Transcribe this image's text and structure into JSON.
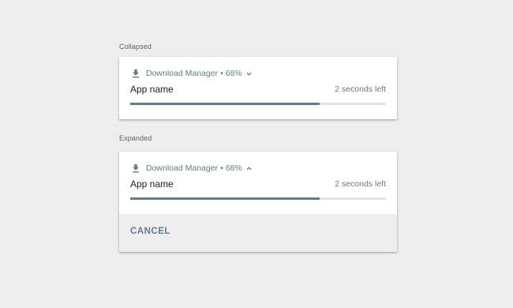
{
  "collapsed": {
    "section_label": "Collapsed",
    "app_title": "Download Manager",
    "separator": "•",
    "percent": "68%",
    "progress_fraction": 0.74,
    "app_name": "App name",
    "time_left": "2 seconds left",
    "header_icon": "download-icon",
    "toggle_icon": "chevron-down-icon"
  },
  "expanded": {
    "section_label": "Expanded",
    "app_title": "Download Manager",
    "separator": "•",
    "percent": "68%",
    "progress_fraction": 0.74,
    "app_name": "App name",
    "time_left": "2 seconds left",
    "header_icon": "download-icon",
    "toggle_icon": "chevron-up-icon",
    "action_label": "CANCEL"
  },
  "colors": {
    "accent": "#607d8b",
    "progress_track": "#dfe5e8",
    "page_background": "#eeeeee",
    "card_background": "#ffffff",
    "footer_background": "#eeeeee"
  }
}
